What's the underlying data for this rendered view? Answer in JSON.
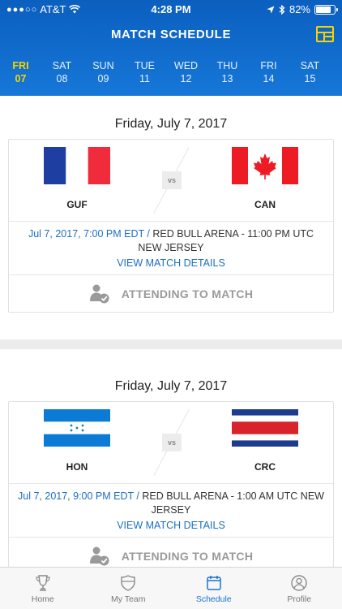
{
  "status": {
    "carrier": "AT&T",
    "time": "4:28 PM",
    "battery": "82%",
    "battery_level": 0.82
  },
  "header": {
    "title": "MATCH SCHEDULE"
  },
  "days": [
    {
      "dow": "FRI",
      "date": "07",
      "active": true
    },
    {
      "dow": "SAT",
      "date": "08"
    },
    {
      "dow": "SUN",
      "date": "09"
    },
    {
      "dow": "TUE",
      "date": "11"
    },
    {
      "dow": "WED",
      "date": "12"
    },
    {
      "dow": "THU",
      "date": "13"
    },
    {
      "dow": "FRI",
      "date": "14"
    },
    {
      "dow": "SAT",
      "date": "15"
    }
  ],
  "matches": [
    {
      "date": "Friday, July 7, 2017",
      "home": "GUF",
      "away": "CAN",
      "vs": "vs",
      "local_time": "Jul 7, 2017, 7:00 PM EDT /",
      "venue_utc": "RED BULL ARENA - 11:00 PM UTC NEW JERSEY",
      "details": "VIEW MATCH DETAILS",
      "attend": "ATTENDING TO MATCH"
    },
    {
      "date": "Friday, July 7, 2017",
      "home": "HON",
      "away": "CRC",
      "vs": "vs",
      "local_time": "Jul 7, 2017, 9:00 PM EDT /",
      "venue_utc": "RED BULL ARENA - 1:00 AM UTC NEW JERSEY",
      "details": "VIEW MATCH DETAILS",
      "attend": "ATTENDING TO MATCH"
    }
  ],
  "tabs": [
    {
      "label": "Home",
      "icon": "trophy-icon"
    },
    {
      "label": "My Team",
      "icon": "shield-icon"
    },
    {
      "label": "Schedule",
      "icon": "calendar-icon",
      "active": true
    },
    {
      "label": "Profile",
      "icon": "user-icon"
    }
  ],
  "colors": {
    "header": "#1677d8",
    "accent": "#f5d400",
    "link": "#1b6fc2"
  }
}
